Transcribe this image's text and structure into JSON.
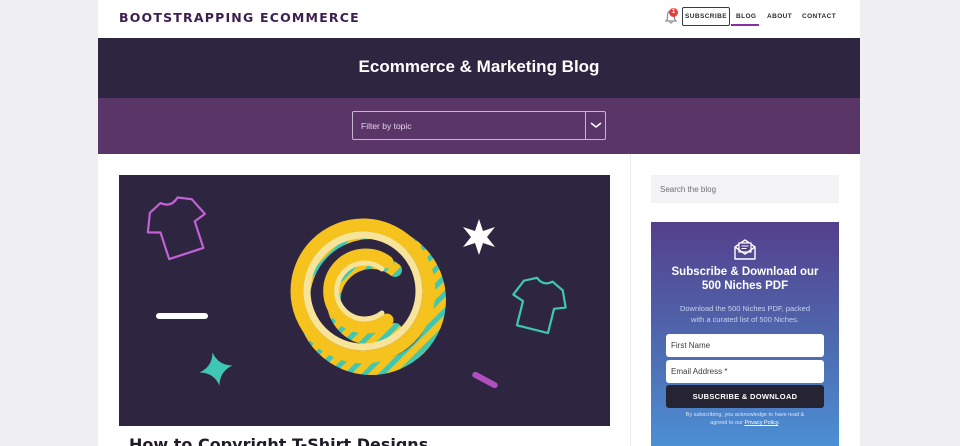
{
  "header": {
    "logo": "BOOTSTRAPPING ECOMMERCE",
    "notification_count": "1",
    "nav": {
      "subscribe": "SUBSCRIBE",
      "blog": "BLOG",
      "about": "ABOUT",
      "contact": "CONTACT"
    }
  },
  "hero": {
    "title": "Ecommerce & Marketing Blog"
  },
  "filter": {
    "placeholder": "Filter by topic"
  },
  "featured_post": {
    "title": "How to Copyright T-Shirt Designs"
  },
  "sidebar": {
    "search_placeholder": "Search the blog",
    "promo": {
      "title_line1": "Subscribe & Download our",
      "title_line2": "500 Niches PDF",
      "desc_line1": "Download the 500 Niches PDF, packed",
      "desc_line2": "with a curated list of 500 Niches.",
      "first_name_placeholder": "First Name",
      "email_placeholder": "Email Address *",
      "button": "SUBSCRIBE & DOWNLOAD",
      "fine_line1": "By subscribing, you acknowledge to have read &",
      "fine_prefix": "agreed to our ",
      "privacy_link": "Privacy Policy",
      "fine_suffix": "."
    }
  },
  "colors": {
    "hero_bg": "#2e2540",
    "filter_band_bg": "#5a3568",
    "accent_purple": "#8a2fa3",
    "copyright_yellow": "#f5c21e",
    "copyright_teal": "#3fc7b3",
    "tshirt_pink": "#c460d8",
    "tshirt_teal": "#3fc7b3"
  },
  "icons": {
    "notification": "bell-icon",
    "filter_dropdown": "chevron-down-icon",
    "newsletter": "envelope-icon",
    "featured_art": "copyright-symbol-illustration"
  }
}
